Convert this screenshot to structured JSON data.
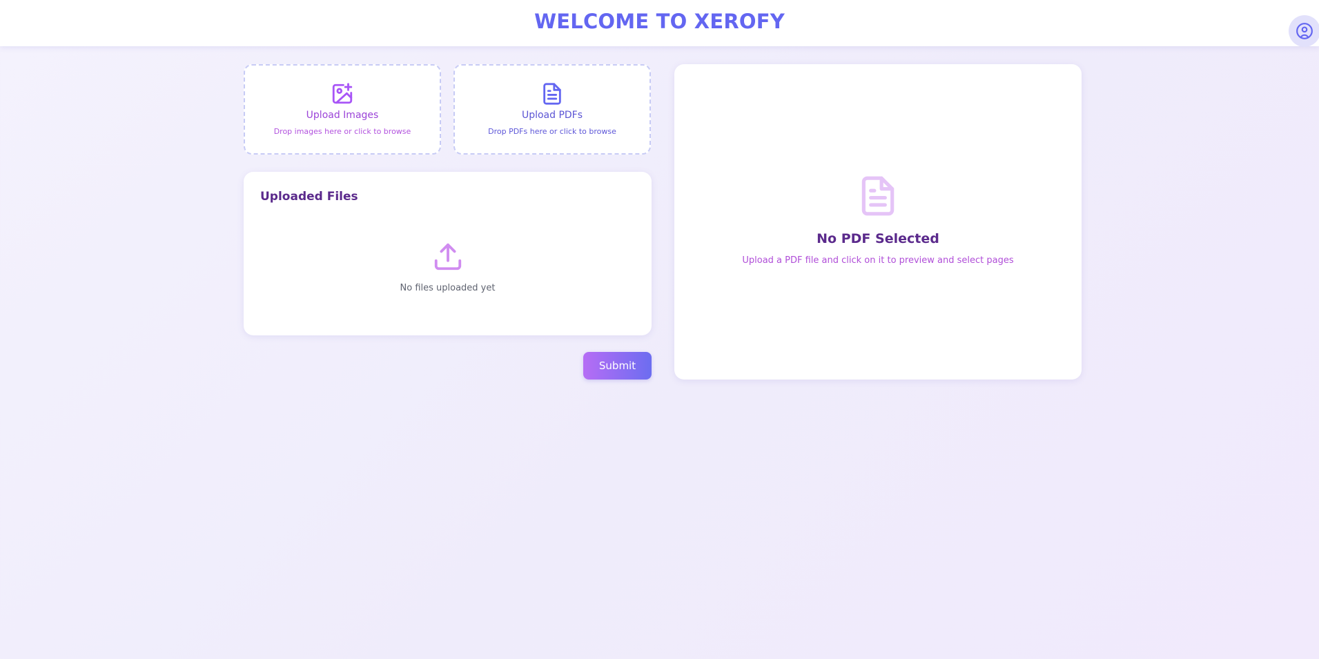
{
  "header": {
    "title": "WELCOME TO XEROFY",
    "profile_icon": "user-circle-icon"
  },
  "upload_images": {
    "title": "Upload Images",
    "subtitle": "Drop images here or click to browse",
    "icon": "image-plus-icon"
  },
  "upload_pdfs": {
    "title": "Upload PDFs",
    "subtitle": "Drop PDFs here or click to browse",
    "icon": "file-text-icon"
  },
  "uploaded_files": {
    "title": "Uploaded Files",
    "empty_text": "No files uploaded yet",
    "icon": "upload-icon"
  },
  "actions": {
    "submit_label": "Submit"
  },
  "preview": {
    "title": "No PDF Selected",
    "subtitle": "Upload a PDF file and click on it to preview and select pages",
    "icon": "file-text-icon"
  },
  "colors": {
    "accent": "#6366f1",
    "purple": "#a855f7",
    "heading": "#5b2a8c"
  }
}
